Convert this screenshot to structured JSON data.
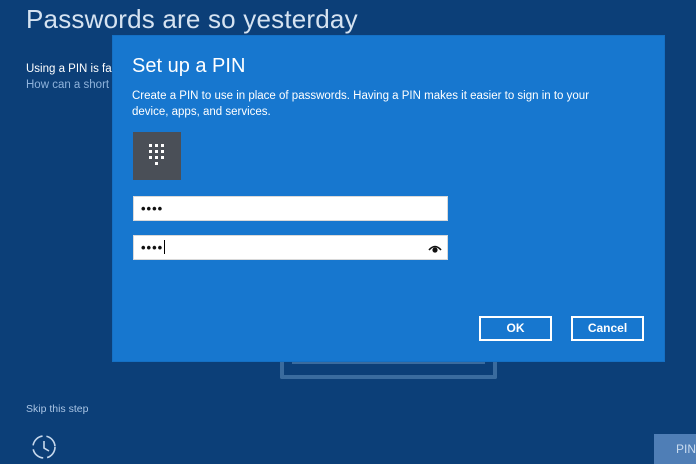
{
  "background": {
    "title": "Passwords are so yesterday",
    "line1": "Using a PIN is fa",
    "line2": "How can a short",
    "skip_label": "Skip this step",
    "next_label": "PIN"
  },
  "dialog": {
    "title": "Set up a PIN",
    "description": "Create a PIN to use in place of passwords. Having a PIN makes it easier to sign in to your device, apps, and services.",
    "pin_value": "••••",
    "confirm_value": "••••",
    "ok_label": "OK",
    "cancel_label": "Cancel"
  },
  "colors": {
    "background": "#0c3f78",
    "dialog": "#1777cf",
    "tile": "#4a4f57"
  },
  "icons": [
    "keypad-icon",
    "eye-icon",
    "ease-of-access-icon"
  ]
}
